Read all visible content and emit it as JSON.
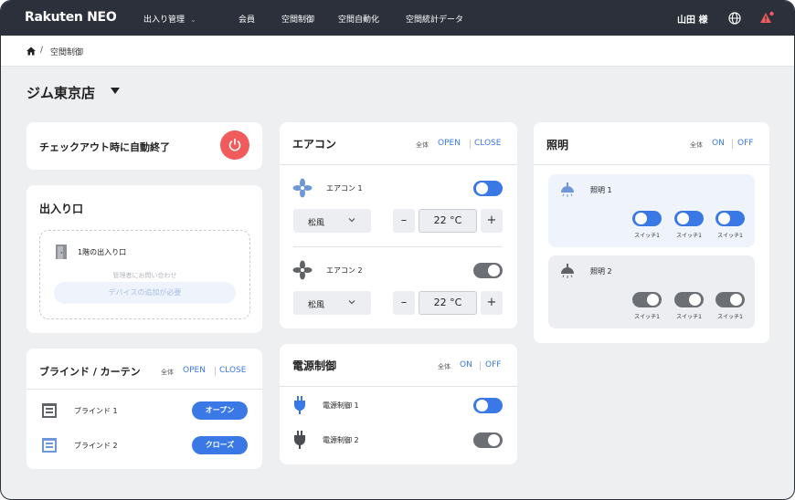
{
  "header": {
    "logo": "Rakuten NEO",
    "nav": [
      "出入り管理",
      "会員",
      "空間制御",
      "空間自動化",
      "空間統計データ"
    ],
    "user": "山田 様"
  },
  "breadcrumb": {
    "separator": "/",
    "current": "空間制御"
  },
  "page": {
    "title": "ジム東京店"
  },
  "checkout": {
    "label": "チェックアウト時に自動終了"
  },
  "entrance": {
    "title": "出入り口",
    "door_label": "1階の出入り口",
    "contact_text": "管理者にお問い合わせ",
    "add_button": "デバイスの追加が必要"
  },
  "blinds": {
    "title": "ブラインド / カーテン",
    "all_label": "全体",
    "open": "OPEN",
    "close": "CLOSE",
    "items": [
      {
        "label": "ブラインド 1",
        "action": "オープン"
      },
      {
        "label": "ブラインド 2",
        "action": "クローズ"
      }
    ]
  },
  "aircon": {
    "title": "エアコン",
    "all_label": "全体",
    "open": "OPEN",
    "close": "CLOSE",
    "units": [
      {
        "label": "エアコン 1",
        "state": "on",
        "mode": "松風",
        "temp": "22 °C"
      },
      {
        "label": "エアコン 2",
        "state": "off",
        "mode": "松風",
        "temp": "22 °C"
      }
    ],
    "minus": "–",
    "plus": "+"
  },
  "power": {
    "title": "電源制御",
    "all_label": "全体",
    "on": "ON",
    "off": "OFF",
    "items": [
      {
        "label": "電源制御 1",
        "state": "on"
      },
      {
        "label": "電源制御 2",
        "state": "off"
      }
    ]
  },
  "lighting": {
    "title": "照明",
    "all_label": "全体",
    "on": "ON",
    "off": "OFF",
    "groups": [
      {
        "label": "照明 1",
        "state": "on",
        "switches": [
          "スイッチ1",
          "スイッチ1",
          "スイッチ1"
        ]
      },
      {
        "label": "照明 2",
        "state": "off",
        "switches": [
          "スイッチ1",
          "スイッチ1",
          "スイッチ1"
        ]
      }
    ]
  },
  "colors": {
    "accent": "#3a78e6",
    "header_bg": "#2b303b",
    "danger": "#f15b5b",
    "toggle_off": "#6c6f74",
    "page_bg": "#eeeff1"
  },
  "icons": [
    "home-icon",
    "globe-icon",
    "alert-icon",
    "power-icon",
    "door-icon",
    "fan-icon",
    "plug-icon",
    "blind-icon",
    "lamp-icon",
    "chevron-down-icon"
  ]
}
